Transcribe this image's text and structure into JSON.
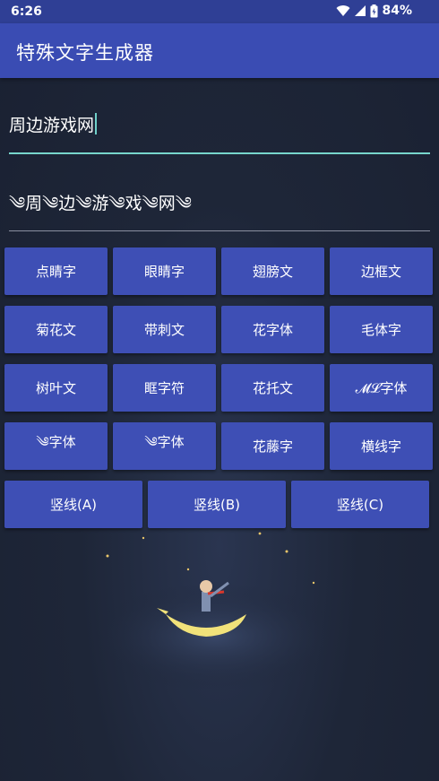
{
  "status_bar": {
    "time": "6:26",
    "battery": "84%",
    "icons": [
      "wifi-icon",
      "signal-icon",
      "battery-icon"
    ]
  },
  "app_bar": {
    "title": "特殊文字生成器"
  },
  "input": {
    "value": "周边游戏网"
  },
  "output": {
    "text": "༄周༄边༄游༄戏༄网༄"
  },
  "buttons": {
    "row1": [
      "点睛字",
      "眼睛字",
      "翅膀文",
      "边框文"
    ],
    "row2": [
      "菊花文",
      "带刺文",
      "花字体",
      "毛体字"
    ],
    "row3": [
      "树叶文",
      "眶字符",
      "花托文",
      "𝓜𝓛字体"
    ],
    "row4": [
      "༄字体",
      "༄字体",
      "花藤字",
      "横线字"
    ],
    "row5": [
      "竖线(A)",
      "竖线(B)",
      "竖线(C)"
    ]
  },
  "colors": {
    "status_bar": "#2f3f95",
    "app_bar": "#3a4cb3",
    "button": "#3e4fb5",
    "accent_underline": "#77d6cc",
    "background": "#1e2638"
  }
}
